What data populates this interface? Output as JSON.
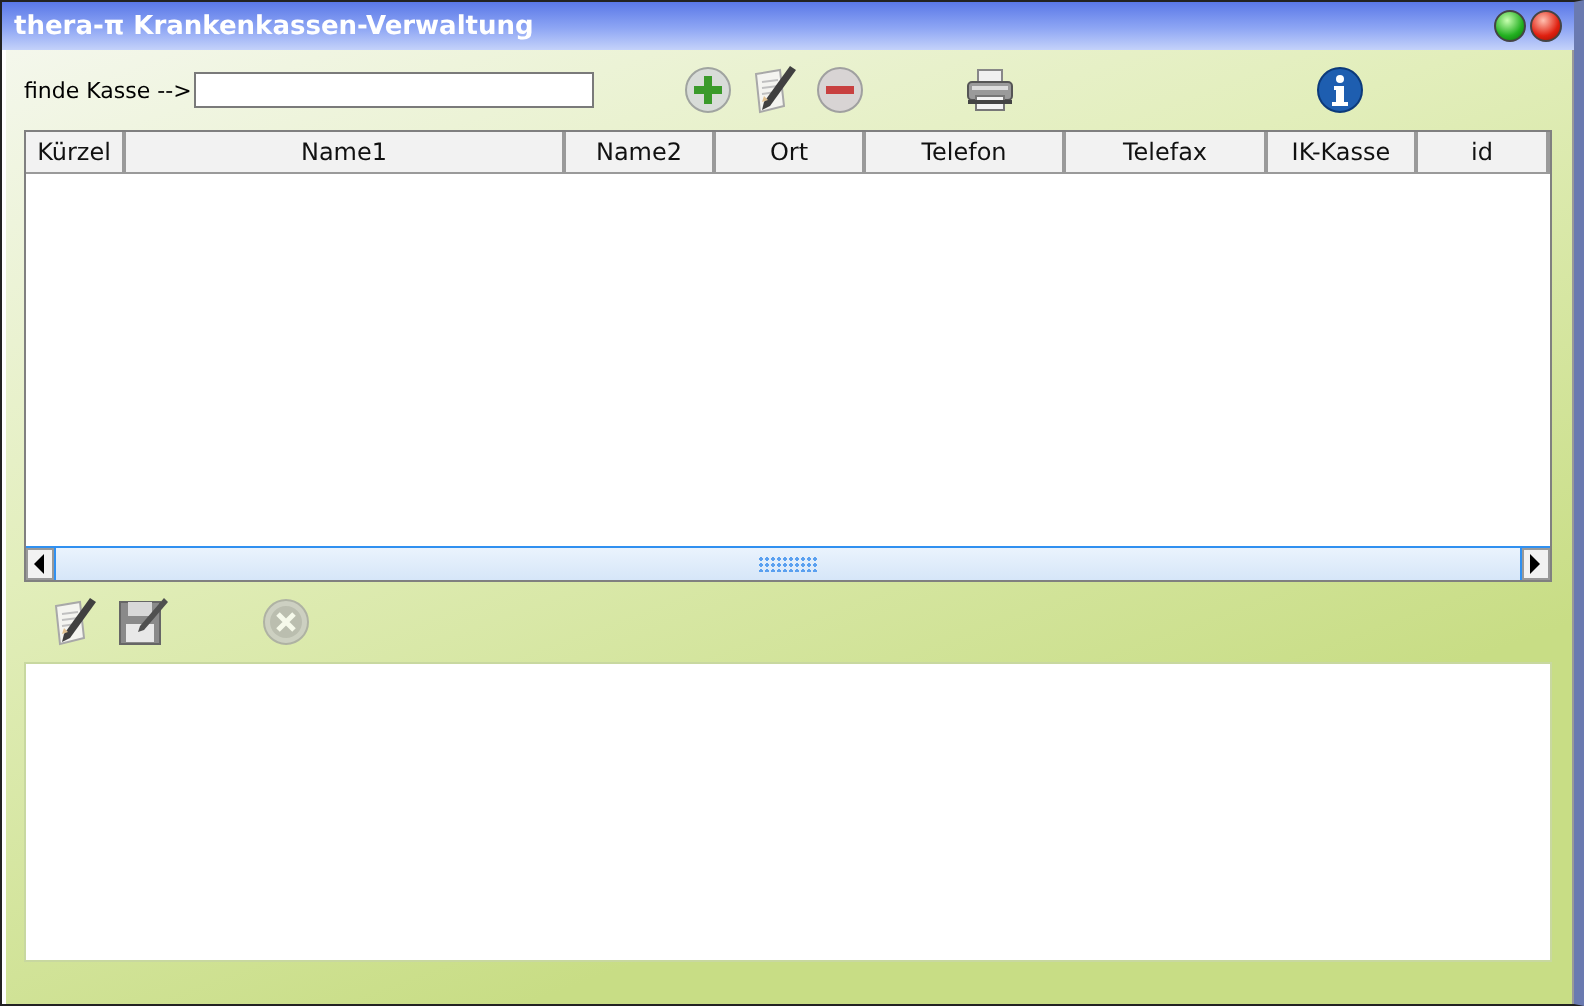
{
  "window": {
    "title": "thera-π Krankenkassen-Verwaltung",
    "controls": [
      {
        "kind": "green"
      },
      {
        "kind": "close"
      }
    ]
  },
  "search": {
    "label": "finde Kasse -->"
  },
  "toolbar": [
    {
      "kind": "add",
      "disabled": false
    },
    {
      "kind": "edit",
      "disabled": false
    },
    {
      "kind": "remove",
      "disabled": false
    },
    {
      "kind": "print",
      "disabled": false
    },
    {
      "kind": "info",
      "disabled": false
    }
  ],
  "table": {
    "columns": [
      "Kürzel",
      "Name1",
      "Name2",
      "Ort",
      "Telefon",
      "Telefax",
      "IK-Kasse",
      "id"
    ]
  },
  "editor_toolbar": [
    {
      "kind": "edit",
      "disabled": false
    },
    {
      "kind": "save",
      "disabled": false
    },
    {
      "kind": "cancel",
      "disabled": true
    }
  ]
}
